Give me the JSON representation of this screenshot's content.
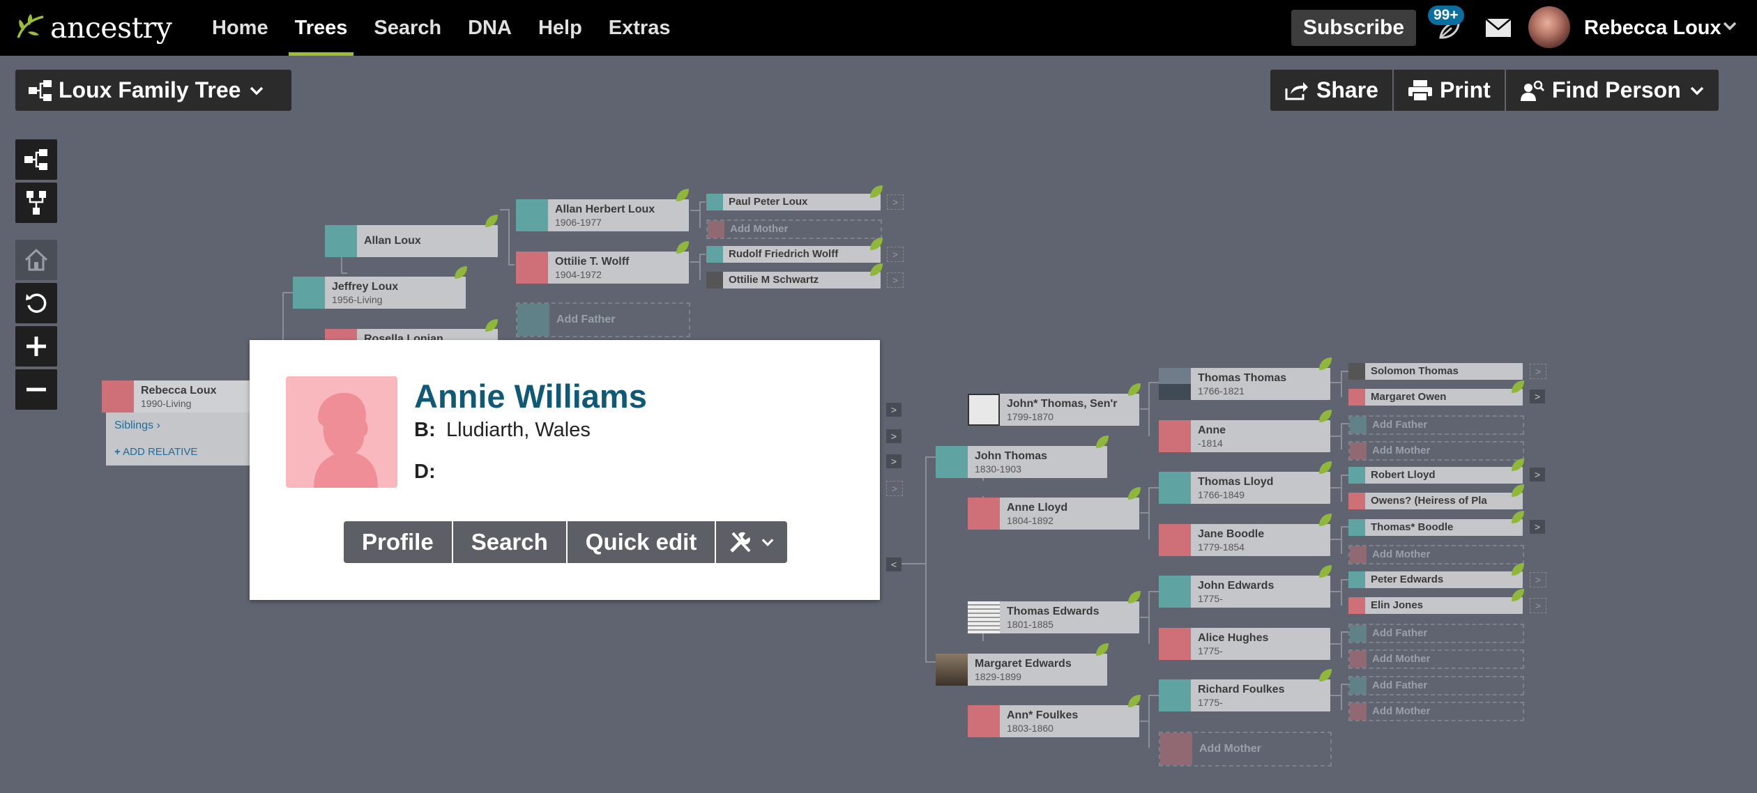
{
  "header": {
    "logo_text": "ancestry",
    "nav": [
      {
        "label": "Home",
        "active": false
      },
      {
        "label": "Trees",
        "active": true
      },
      {
        "label": "Search",
        "active": false
      },
      {
        "label": "DNA",
        "active": false
      },
      {
        "label": "Help",
        "active": false
      },
      {
        "label": "Extras",
        "active": false
      }
    ],
    "subscribe_label": "Subscribe",
    "hints_badge": "99+",
    "user_name": "Rebecca Loux",
    "accent_color": "#9cbe30"
  },
  "toolbar": {
    "tree_name": "Loux Family Tree",
    "share_label": "Share",
    "print_label": "Print",
    "find_person_label": "Find Person"
  },
  "side_tools": [
    "pedigree-view-icon",
    "family-view-icon",
    "home-icon",
    "reset-icon",
    "zoom-in-icon",
    "zoom-out-icon"
  ],
  "root_person": {
    "name": "Rebecca Loux",
    "dates": "1990-Living",
    "siblings_label": "Siblings",
    "add_relative_label": "ADD RELATIVE"
  },
  "people": {
    "p1": {
      "name": "Jeffrey Loux",
      "dates": "1956-Living"
    },
    "p2": {
      "name": "Allan Loux",
      "dates": ""
    },
    "p3": {
      "name": "Allan Herbert Loux",
      "dates": "1906-1977"
    },
    "p4": {
      "name": "Ottilie T. Wolff",
      "dates": "1904-1972"
    },
    "p5": {
      "name": "Paul Peter Loux"
    },
    "p6": {
      "name": "Add Mother"
    },
    "p7": {
      "name": "Rudolf Friedrich Wolff"
    },
    "p8": {
      "name": "Ottilie M Schwartz"
    },
    "p9": {
      "name": "Add Father"
    },
    "p10": {
      "name": "Rosella Lonjan"
    },
    "q1": {
      "name": "John Thomas",
      "dates": "1830-1903"
    },
    "q2": {
      "name": "John* Thomas, Sen'r",
      "dates": "1799-1870"
    },
    "q3": {
      "name": "Anne Lloyd",
      "dates": "1804-1892"
    },
    "q4": {
      "name": "Thomas Thomas",
      "dates": "1766-1821"
    },
    "q5": {
      "name": "Anne",
      "dates": "-1814"
    },
    "q6": {
      "name": "Thomas Lloyd",
      "dates": "1766-1849"
    },
    "q7": {
      "name": "Jane Boodle",
      "dates": "1779-1854"
    },
    "q8": {
      "name": "Solomon Thomas"
    },
    "q9": {
      "name": "Margaret Owen"
    },
    "q10": {
      "name": "Add Father"
    },
    "q11": {
      "name": "Add Mother"
    },
    "q12": {
      "name": "Robert Lloyd"
    },
    "q13": {
      "name": "Owens? (Heiress of Pla"
    },
    "q14": {
      "name": "Thomas* Boodle"
    },
    "q15": {
      "name": "Add Mother"
    },
    "r1": {
      "name": "Margaret Edwards",
      "dates": "1829-1899"
    },
    "r2": {
      "name": "Thomas Edwards",
      "dates": "1801-1885"
    },
    "r3": {
      "name": "Ann* Foulkes",
      "dates": "1803-1860"
    },
    "r4": {
      "name": "John Edwards",
      "dates": "1775-"
    },
    "r5": {
      "name": "Alice Hughes",
      "dates": "1775-"
    },
    "r6": {
      "name": "Richard Foulkes",
      "dates": "1775-"
    },
    "r7": {
      "name": "Add Mother"
    },
    "r8": {
      "name": "Peter Edwards"
    },
    "r9": {
      "name": "Elin Jones"
    },
    "r10": {
      "name": "Add Father"
    },
    "r11": {
      "name": "Add Mother"
    },
    "r12": {
      "name": "Add Father"
    },
    "r13": {
      "name": "Add Mother"
    }
  },
  "popup": {
    "name": "Annie Williams",
    "birth_label": "B:",
    "birth": "Lludiarth, Wales",
    "death_label": "D:",
    "death": "",
    "buttons": {
      "profile": "Profile",
      "search": "Search",
      "quick_edit": "Quick edit"
    },
    "tools_icon": "tools-icon"
  }
}
